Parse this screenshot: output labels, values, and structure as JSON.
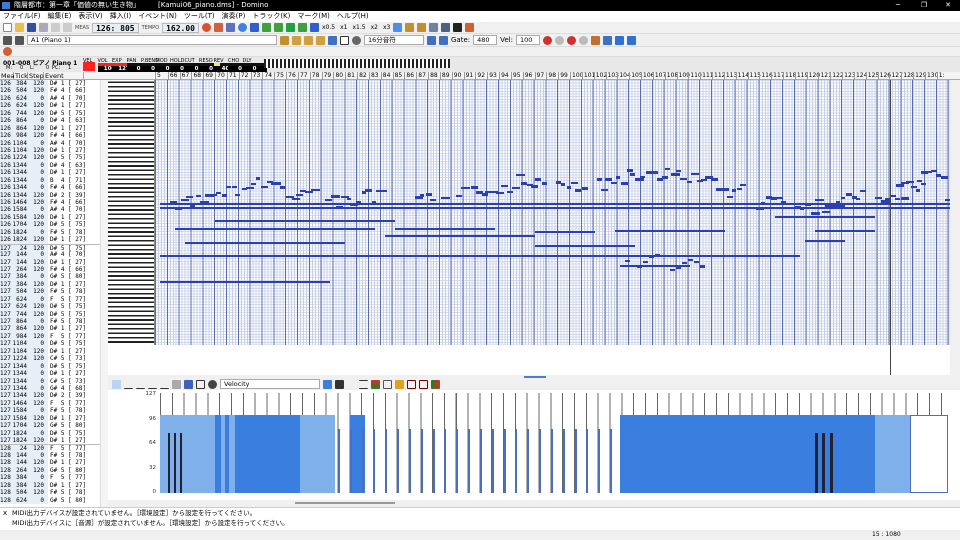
{
  "window": {
    "title": "階層都市：第一章「価値の無い生き物」",
    "file": "[Kamui06_piano.dms] - Domino",
    "minimize": "─",
    "maximize": "❐",
    "close": "✕"
  },
  "menu": [
    "ファイル(F)",
    "編集(E)",
    "表示(V)",
    "挿入(I)",
    "イベント(N)",
    "ツール(T)",
    "演奏(P)",
    "トラック(K)",
    "マーク(M)",
    "ヘルプ(H)"
  ],
  "toolbar": {
    "meas_label": "MEAS",
    "meas_value": "126: 805",
    "tempo_label": "TEMPO",
    "tempo_value": "162.00",
    "speeds": [
      "x0.5",
      "x1",
      "x1.5",
      "x2",
      "x3"
    ],
    "track_select": "A1 (Piano 1)",
    "note_length": "16分音符",
    "gate_label": "Gate:",
    "gate_value": "480",
    "vel_label": "Vel:",
    "vel_value": "100"
  },
  "track_info": {
    "name": "001-008 ピアノ Piano 1",
    "m_label": "M:",
    "m_value": "0",
    "l_label": "L:",
    "l_value": "0",
    "pc_label": "PC:",
    "pc_value": "1",
    "meters": [
      {
        "label": "VEL",
        "value": ""
      },
      {
        "label": "VOL",
        "value": "100"
      },
      {
        "label": "EXP",
        "value": "127"
      },
      {
        "label": "PAN",
        "value": "0"
      },
      {
        "label": "P.BEND",
        "value": "0"
      },
      {
        "label": "MOD",
        "value": "0"
      },
      {
        "label": "HOLD",
        "value": "0"
      },
      {
        "label": "CUT",
        "value": "0"
      },
      {
        "label": "RESO",
        "value": "0"
      },
      {
        "label": "REV",
        "value": "40"
      },
      {
        "label": "CHO",
        "value": "0"
      },
      {
        "label": "DLY",
        "value": "0"
      }
    ]
  },
  "event_list": {
    "headers": [
      "Mea",
      "Tick",
      "Step",
      "Event"
    ],
    "rows": [
      [
        "126",
        "384",
        "120",
        "D# 1 [ 27]"
      ],
      [
        "126",
        "504",
        "120",
        "F# 4 [ 66]"
      ],
      [
        "126",
        "624",
        "0",
        "A# 4 [ 70]"
      ],
      [
        "126",
        "624",
        "120",
        "D# 1 [ 27]"
      ],
      [
        "126",
        "744",
        "120",
        "D# 5 [ 75]"
      ],
      [
        "126",
        "864",
        "0",
        "D# 4 [ 63]"
      ],
      [
        "126",
        "864",
        "120",
        "D# 1 [ 27]"
      ],
      [
        "126",
        "984",
        "120",
        "F# 4 [ 66]"
      ],
      [
        "126",
        "1104",
        "0",
        "A# 4 [ 70]"
      ],
      [
        "126",
        "1104",
        "120",
        "D# 1 [ 27]"
      ],
      [
        "126",
        "1224",
        "120",
        "D# 5 [ 75]"
      ],
      [
        "126",
        "1344",
        "0",
        "D# 4 [ 63]"
      ],
      [
        "126",
        "1344",
        "0",
        "D# 1 [ 27]"
      ],
      [
        "126",
        "1344",
        "0",
        "B  4 [ 71]"
      ],
      [
        "126",
        "1344",
        "0",
        "F# 4 [ 66]"
      ],
      [
        "126",
        "1344",
        "120",
        "D# 2 [ 39]"
      ],
      [
        "126",
        "1464",
        "120",
        "F# 4 [ 66]"
      ],
      [
        "126",
        "1584",
        "0",
        "A# 4 [ 70]"
      ],
      [
        "126",
        "1584",
        "120",
        "D# 1 [ 27]"
      ],
      [
        "126",
        "1704",
        "120",
        "D# 5 [ 75]"
      ],
      [
        "126",
        "1824",
        "0",
        "F# 5 [ 78]"
      ],
      [
        "126",
        "1824",
        "120",
        "D# 1 [ 27]"
      ],
      [
        "127",
        "24",
        "120",
        "D# 5 [ 75]"
      ],
      [
        "127",
        "144",
        "0",
        "A# 4 [ 70]"
      ],
      [
        "127",
        "144",
        "120",
        "D# 1 [ 27]"
      ],
      [
        "127",
        "264",
        "120",
        "F# 4 [ 66]"
      ],
      [
        "127",
        "384",
        "0",
        "G# 5 [ 80]"
      ],
      [
        "127",
        "384",
        "120",
        "D# 1 [ 27]"
      ],
      [
        "127",
        "504",
        "120",
        "F# 5 [ 78]"
      ],
      [
        "127",
        "624",
        "0",
        "F  5 [ 77]"
      ],
      [
        "127",
        "624",
        "120",
        "D# 5 [ 75]"
      ],
      [
        "127",
        "744",
        "120",
        "D# 5 [ 75]"
      ],
      [
        "127",
        "864",
        "0",
        "F# 5 [ 78]"
      ],
      [
        "127",
        "864",
        "120",
        "D# 1 [ 27]"
      ],
      [
        "127",
        "984",
        "120",
        "F  5 [ 77]"
      ],
      [
        "127",
        "1104",
        "0",
        "D# 5 [ 75]"
      ],
      [
        "127",
        "1104",
        "120",
        "D# 1 [ 27]"
      ],
      [
        "127",
        "1224",
        "120",
        "C# 5 [ 73]"
      ],
      [
        "127",
        "1344",
        "0",
        "D# 5 [ 75]"
      ],
      [
        "127",
        "1344",
        "0",
        "D# 1 [ 27]"
      ],
      [
        "127",
        "1344",
        "0",
        "C# 5 [ 73]"
      ],
      [
        "127",
        "1344",
        "0",
        "G# 4 [ 68]"
      ],
      [
        "127",
        "1344",
        "120",
        "D# 2 [ 39]"
      ],
      [
        "127",
        "1464",
        "120",
        "F  5 [ 77]"
      ],
      [
        "127",
        "1584",
        "0",
        "F# 5 [ 78]"
      ],
      [
        "127",
        "1584",
        "120",
        "D# 1 [ 27]"
      ],
      [
        "127",
        "1704",
        "120",
        "G# 5 [ 80]"
      ],
      [
        "127",
        "1824",
        "0",
        "D# 5 [ 75]"
      ],
      [
        "127",
        "1824",
        "120",
        "D# 1 [ 27]"
      ],
      [
        "128",
        "24",
        "120",
        "F  5 [ 77]"
      ],
      [
        "128",
        "144",
        "0",
        "F# 5 [ 78]"
      ],
      [
        "128",
        "144",
        "120",
        "D# 1 [ 27]"
      ],
      [
        "128",
        "264",
        "120",
        "G# 5 [ 80]"
      ],
      [
        "128",
        "384",
        "0",
        "F  5 [ 77]"
      ],
      [
        "128",
        "384",
        "120",
        "D# 1 [ 27]"
      ],
      [
        "128",
        "504",
        "120",
        "F# 5 [ 78]"
      ],
      [
        "128",
        "624",
        "0",
        "G# 5 [ 80]"
      ]
    ]
  },
  "measures": [
    "5",
    "66",
    "67",
    "68",
    "69",
    "70",
    "71",
    "72",
    "73",
    "74",
    "75",
    "76",
    "77",
    "78",
    "79",
    "80",
    "81",
    "82",
    "83",
    "84",
    "85",
    "86",
    "87",
    "88",
    "89",
    "90",
    "91",
    "92",
    "93",
    "94",
    "95",
    "96",
    "97",
    "98",
    "99",
    "100",
    "101",
    "102",
    "103",
    "104",
    "105",
    "106",
    "107",
    "108",
    "109",
    "110",
    "111",
    "112",
    "113",
    "114",
    "115",
    "116",
    "117",
    "118",
    "119",
    "120",
    "121",
    "122",
    "123",
    "124",
    "125",
    "126",
    "127",
    "128",
    "129",
    "130",
    "1:"
  ],
  "velocity_panel": {
    "select": "Velocity",
    "labels": [
      "127",
      "96",
      "64",
      "32",
      "0"
    ]
  },
  "messages": [
    "MIDI出力デバイスが設定されていません。［環境設定］から設定を行ってください。",
    "MIDI出力デバイスに［音源］が設定されていません。［環境設定］から設定を行ってください。"
  ],
  "messages_close": "x",
  "status": {
    "position": "15 : 1080"
  },
  "colors": {
    "note": "#2b3fae",
    "velocity_light": "#7fb0ea",
    "velocity_dark": "#3a7fe0",
    "meter_red": "#ff2020"
  }
}
